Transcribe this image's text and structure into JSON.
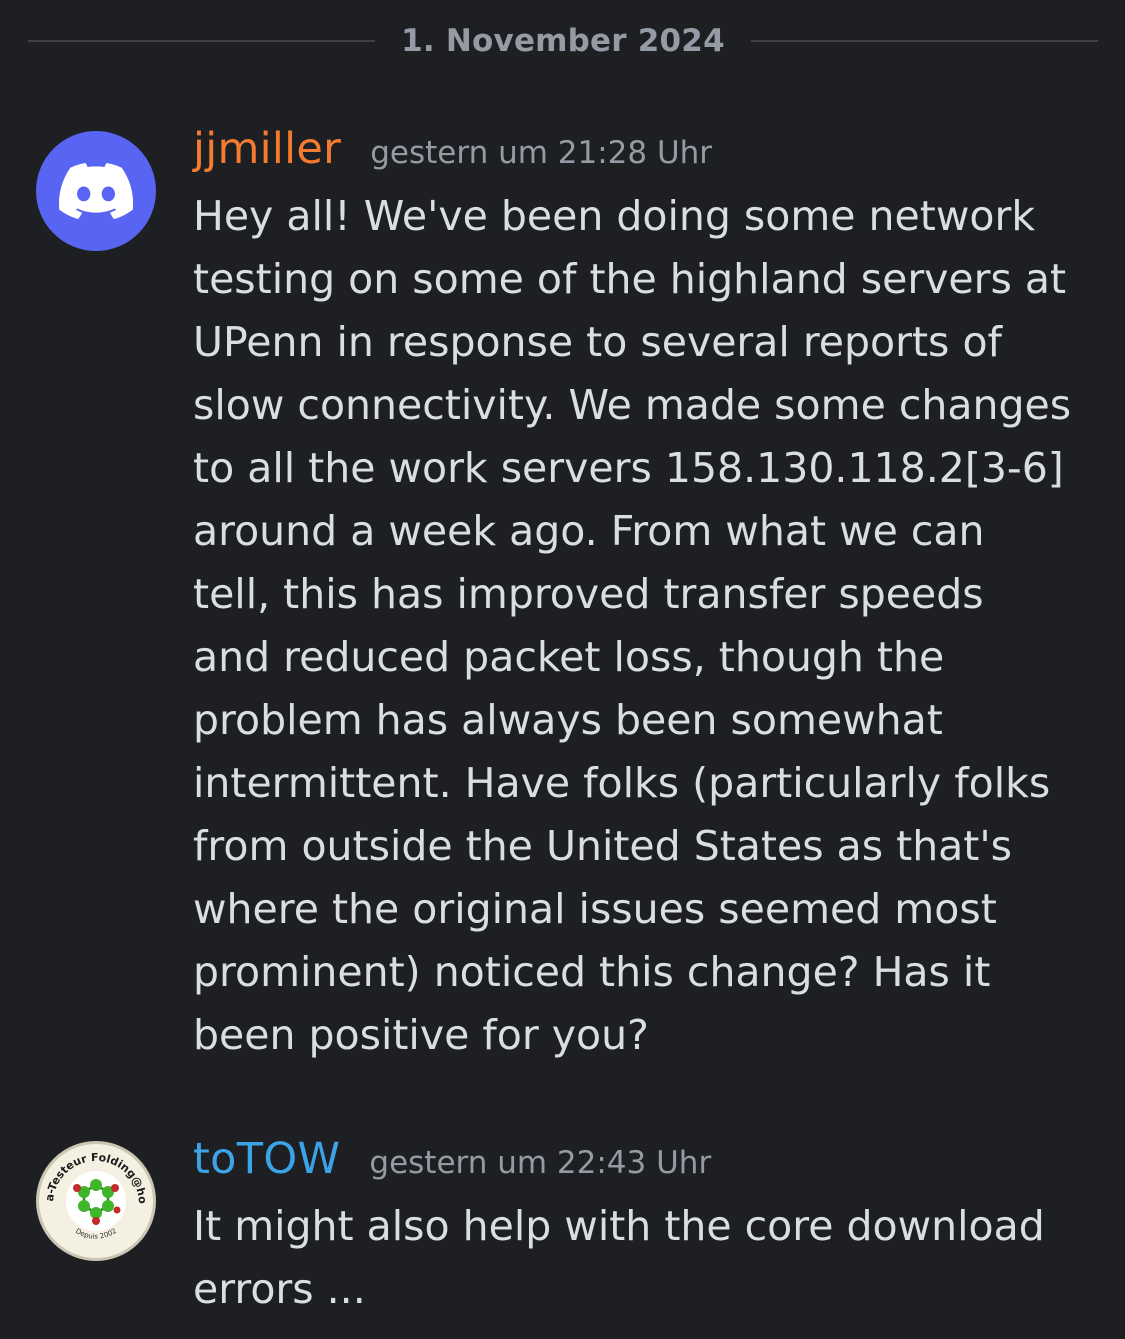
{
  "date_divider": "1. November 2024",
  "colors": {
    "background": "#1e1f22",
    "username_jjmiller": "#f47b30",
    "username_totow": "#3ba3e6",
    "timestamp": "#949ba4",
    "message_text": "#dbdee1",
    "discord_avatar": "#5865f2"
  },
  "messages": [
    {
      "author": "jjmiller",
      "timestamp": "gestern um 21:28 Uhr",
      "avatar_icon": "discord-logo-icon",
      "text": "Hey all! We've been doing some network testing on some of the highland servers at UPenn in response to several reports of slow connectivity. We made some changes to all the work servers 158.130.118.2[3-6] around a week ago. From what we can tell, this has improved transfer speeds and reduced packet loss, though the problem has always been somewhat intermittent. Have folks (particularly folks from outside the United States as that's where the original issues seemed most prominent) noticed this change? Has it been positive for you?"
    },
    {
      "author": "toTOW",
      "timestamp": "gestern um 22:43 Uhr",
      "avatar_icon": "folding-at-home-badge-icon",
      "avatar_badge_text": "Bêta-Testeur Folding@home",
      "avatar_badge_subtext": "Depuis 2002",
      "text": "It might also help with the core download errors ..."
    }
  ]
}
